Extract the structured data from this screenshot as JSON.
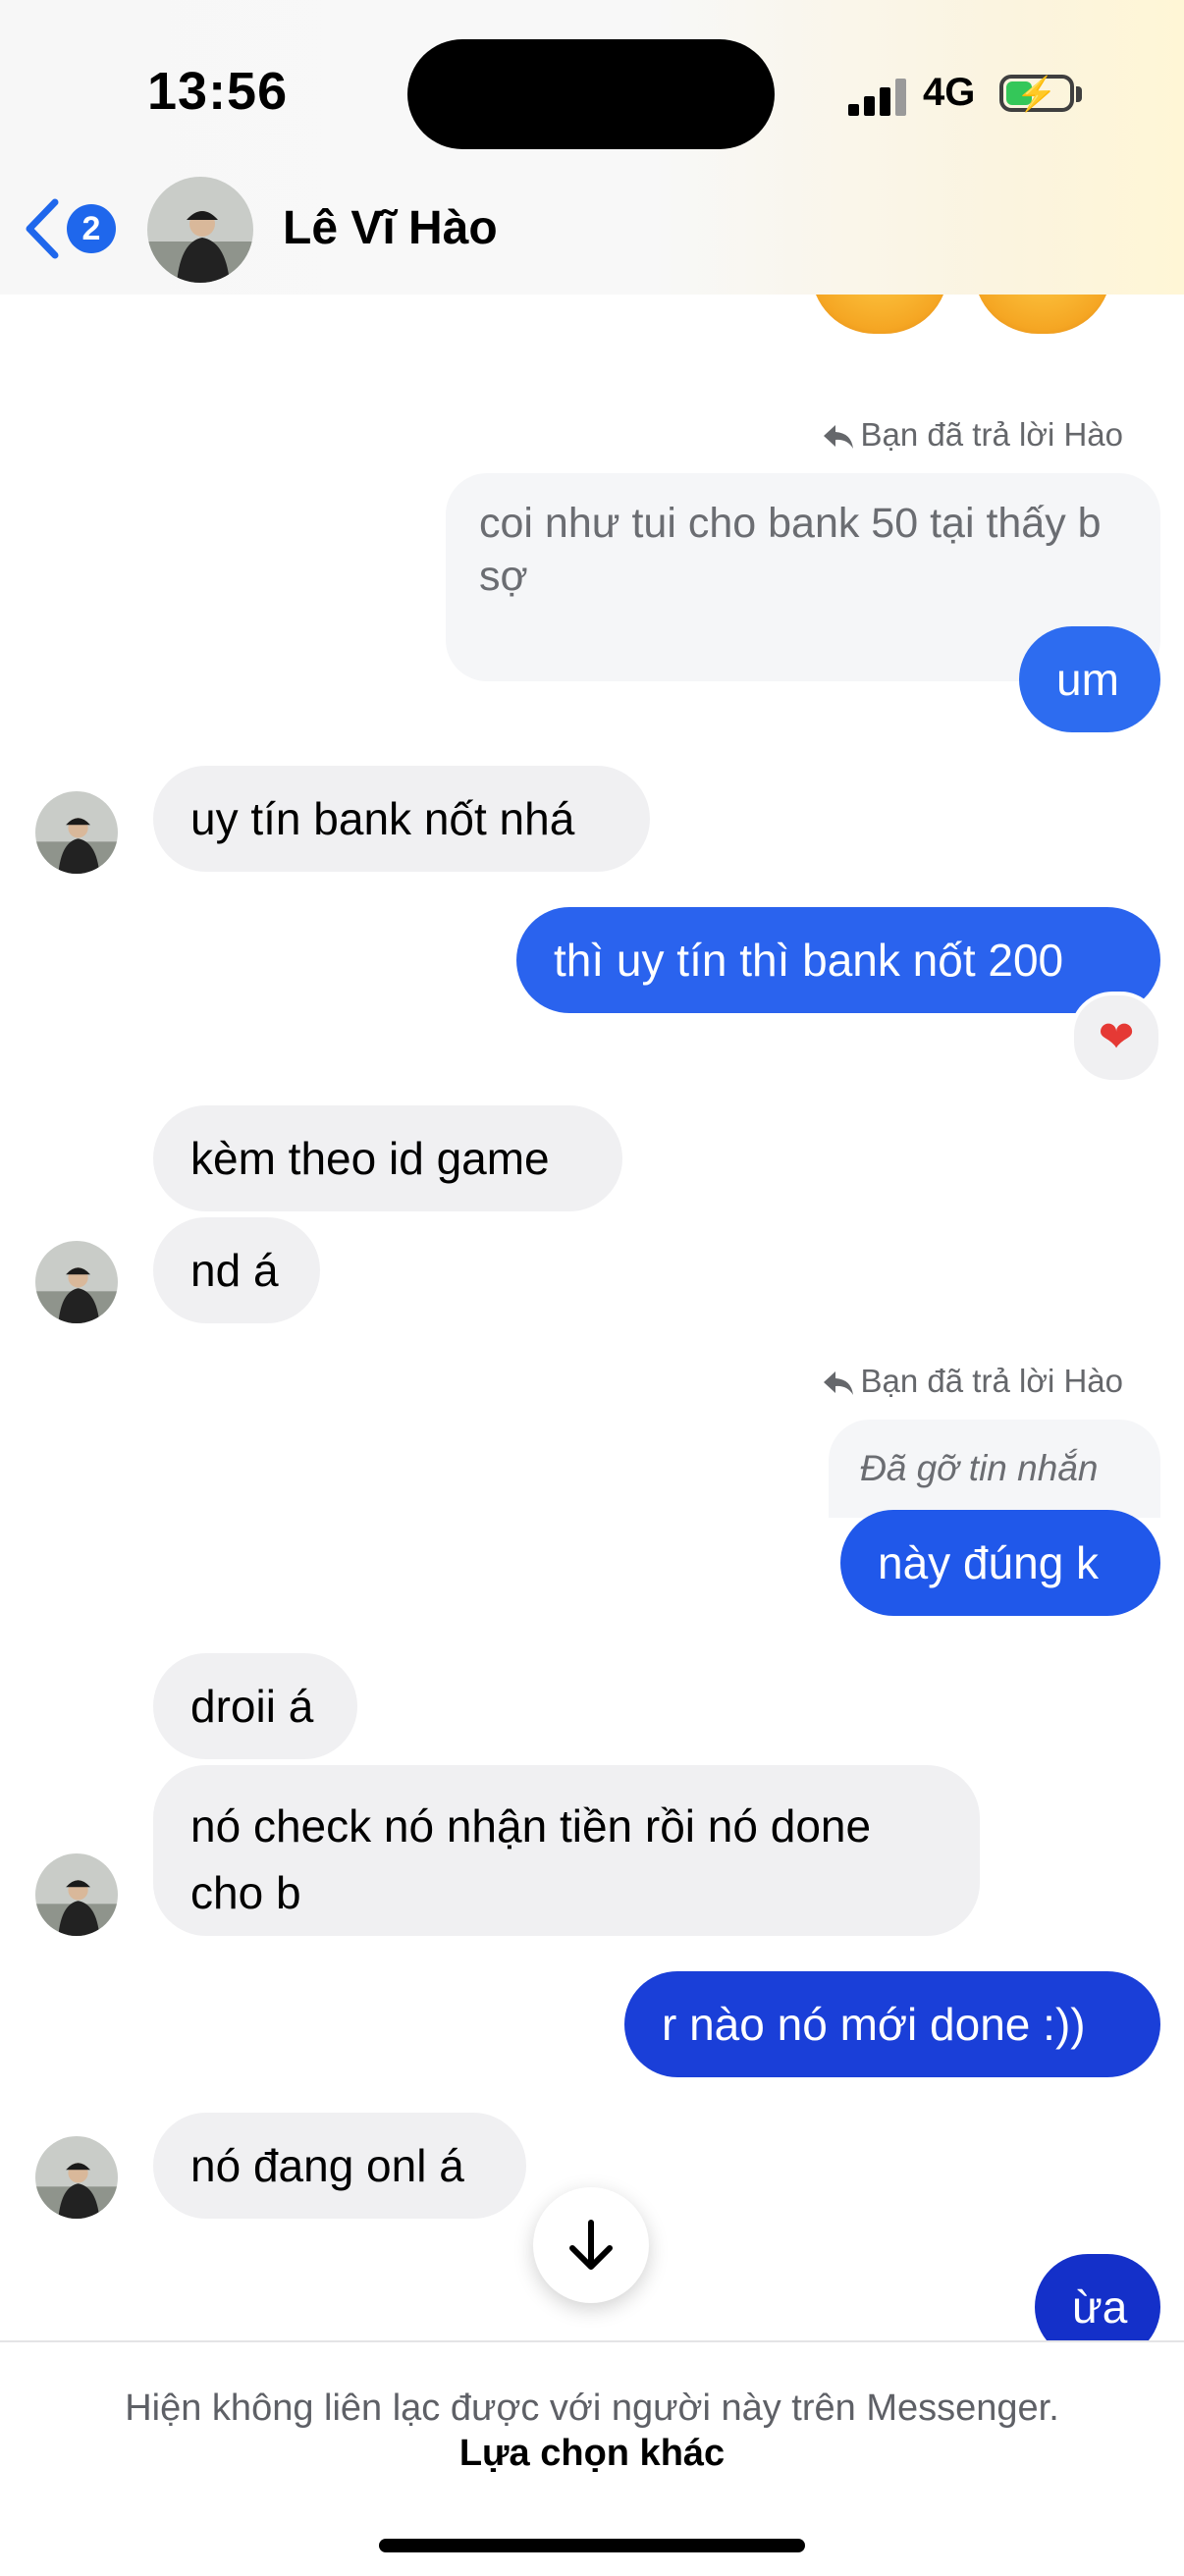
{
  "status_bar": {
    "time": "13:56",
    "network": "4G",
    "battery_icon": "battery-charging-icon"
  },
  "header": {
    "back_badge": "2",
    "contact_name": "Lê Vĩ Hào"
  },
  "messages": [
    {
      "reply_label": "Bạn đã trả lời Hào",
      "quoted": "coi như tui cho bank 50 tại thấy b sợ",
      "text": "um"
    },
    {
      "text": "uy tín bank nốt nhá"
    },
    {
      "text": "thì uy tín thì bank nốt 200",
      "reaction": "❤"
    },
    {
      "text": "kèm theo id game"
    },
    {
      "text": "nd á"
    },
    {
      "reply_label": "Bạn đã trả lời Hào",
      "quoted": "Đã gỡ tin nhắn",
      "text": "này đúng k"
    },
    {
      "text": "droii á"
    },
    {
      "text": "nó check nó nhận tiền rồi nó done cho b"
    },
    {
      "text": "r nào nó mới done :))"
    },
    {
      "text": "nó đang onl á"
    },
    {
      "text": "ừa"
    }
  ],
  "footer": {
    "notice": "Hiện không liên lạc được với người này trên Messenger.",
    "action": "Lựa chọn khác"
  },
  "colors": {
    "accent": "#1f67ec",
    "bubble_blue_top": "#2f6cf0",
    "bubble_blue_bottom": "#1430c9",
    "incoming_bubble": "#f0f0f2"
  }
}
